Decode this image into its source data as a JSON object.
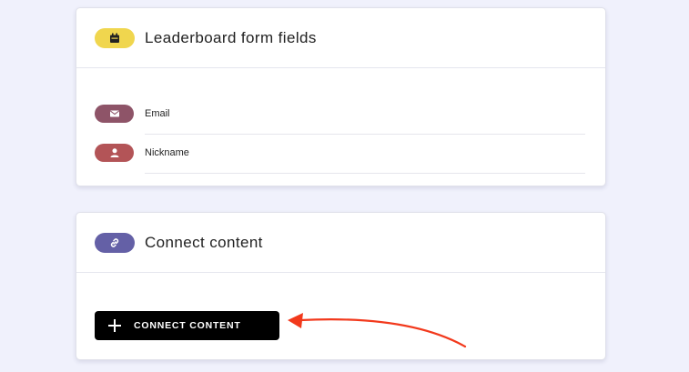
{
  "leaderboard_card": {
    "title": "Leaderboard form fields",
    "icon": "calendar-badge-icon",
    "icon_color": "#f0d64e",
    "fields": [
      {
        "label": "Email",
        "icon": "envelope-icon",
        "color": "#8e5468"
      },
      {
        "label": "Nickname",
        "icon": "person-icon",
        "color": "#b35457"
      }
    ]
  },
  "connect_card": {
    "title": "Connect content",
    "icon": "link-icon",
    "icon_color": "#6460a6",
    "button_label": "CONNECT CONTENT",
    "button_icon": "plus-icon",
    "annotation_arrow_color": "#f2391c"
  }
}
